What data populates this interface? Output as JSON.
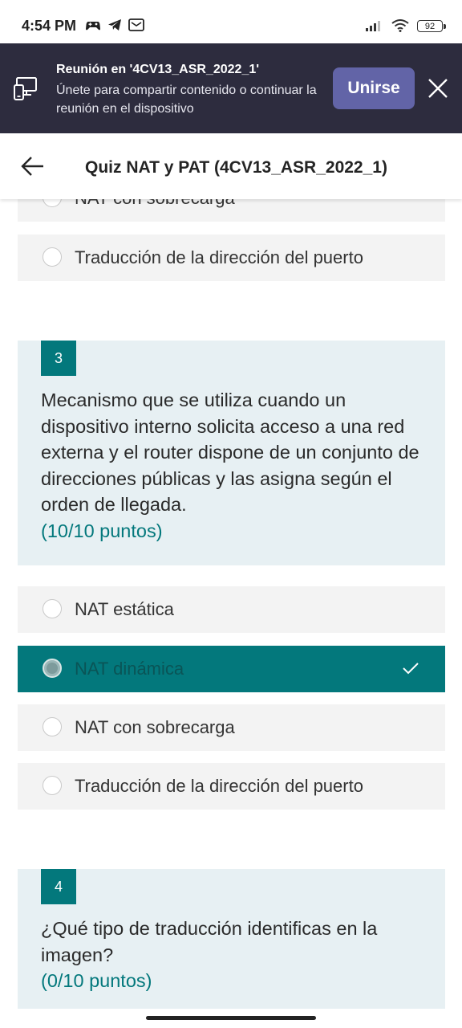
{
  "status_bar": {
    "time": "4:54 PM",
    "battery": "92"
  },
  "banner": {
    "title": "Reunión en '4CV13_ASR_2022_1'",
    "subtitle": "Únete para compartir contenido o continuar la reunión en el dispositivo",
    "join_label": "Unirse"
  },
  "header": {
    "title": "Quiz NAT y PAT (4CV13_ASR_2022_1)"
  },
  "q2_tail": {
    "options": [
      {
        "label": "NAT con sobrecarga"
      },
      {
        "label": "Traducción de la dirección del puerto"
      }
    ]
  },
  "q3": {
    "number": "3",
    "text": "Mecanismo que se utiliza cuando un dispositivo interno solicita acceso a una red externa y el router dispone de un conjunto de direcciones públicas y las asigna según el orden de llegada.",
    "points": "(10/10 puntos)",
    "options": [
      {
        "label": "NAT estática",
        "selected": false
      },
      {
        "label": "NAT dinámica",
        "selected": true
      },
      {
        "label": "NAT con sobrecarga",
        "selected": false
      },
      {
        "label": "Traducción de la dirección del puerto",
        "selected": false
      }
    ]
  },
  "q4": {
    "number": "4",
    "text": "¿Qué tipo de traducción identificas en la imagen?",
    "points": "(0/10 puntos)"
  },
  "colors": {
    "accent": "#03787c",
    "banner": "#2d2c3e",
    "join": "#6264a7",
    "question_bg": "#e7f0f3",
    "option_bg": "#f3f3f3"
  },
  "icons": [
    "game-controller-icon",
    "telegram-icon",
    "message-icon",
    "signal-icon",
    "wifi-icon",
    "battery-icon",
    "device-share-icon",
    "close-icon",
    "back-arrow-icon",
    "check-icon"
  ]
}
